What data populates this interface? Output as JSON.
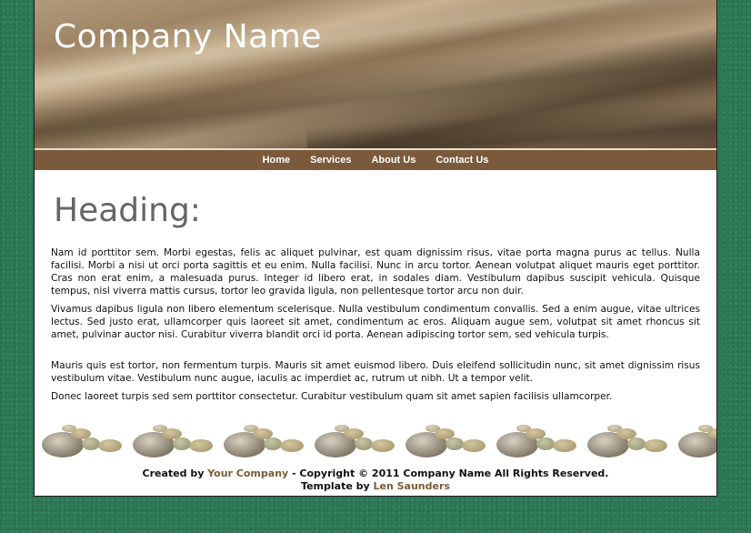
{
  "header": {
    "company_name": "Company Name"
  },
  "nav": {
    "items": [
      {
        "label": "Home"
      },
      {
        "label": "Services"
      },
      {
        "label": "About Us"
      },
      {
        "label": "Contact Us"
      }
    ]
  },
  "main": {
    "heading": "Heading:",
    "paragraphs": [
      "Nam id porttitor sem. Morbi egestas, felis ac aliquet pulvinar, est quam dignissim risus, vitae porta magna purus ac tellus. Nulla facilisi. Morbi a nisi ut orci porta sagittis et eu enim. Nulla facilisi. Nunc in arcu tortor. Aenean volutpat aliquet mauris eget porttitor. Cras non erat enim, a malesuada purus. Integer id libero erat, in sodales diam. Vestibulum dapibus suscipit vehicula. Quisque tempus, nisl viverra mattis cursus, tortor leo gravida ligula, non pellentesque tortor arcu non duir.",
      "Vivamus dapibus ligula non libero elementum scelerisque. Nulla vestibulum condimentum convallis. Sed a enim augue, vitae ultrices lectus. Sed justo erat, ullamcorper quis laoreet sit amet, condimentum ac eros. Aliquam augue sem, volutpat sit amet rhoncus sit amet, pulvinar auctor nisi. Curabitur viverra blandit orci id porta. Aenean adipiscing tortor sem, sed vehicula turpis.",
      "Mauris quis est tortor, non fermentum turpis. Mauris sit amet euismod libero. Duis eleifend sollicitudin nunc, sit amet dignissim risus vestibulum vitae. Vestibulum nunc augue, iaculis ac imperdiet ac, rutrum ut nibh. Ut a tempor velit.",
      "Donec laoreet turpis sed sem porttitor consectetur. Curabitur vestibulum quam sit amet sapien facilisis ullamcorper."
    ]
  },
  "footer": {
    "created_by_prefix": "Created by ",
    "your_company_link": "Your Company",
    "copyright_text": " - Copyright © 2011 Company Name All Rights Reserved.",
    "template_by_prefix": "Template by ",
    "author_link": "Len Saunders"
  },
  "colors": {
    "background": "#2e7a56",
    "nav_bar": "#7b5a3c",
    "footer_link": "#7a5a36",
    "heading": "#666666"
  }
}
